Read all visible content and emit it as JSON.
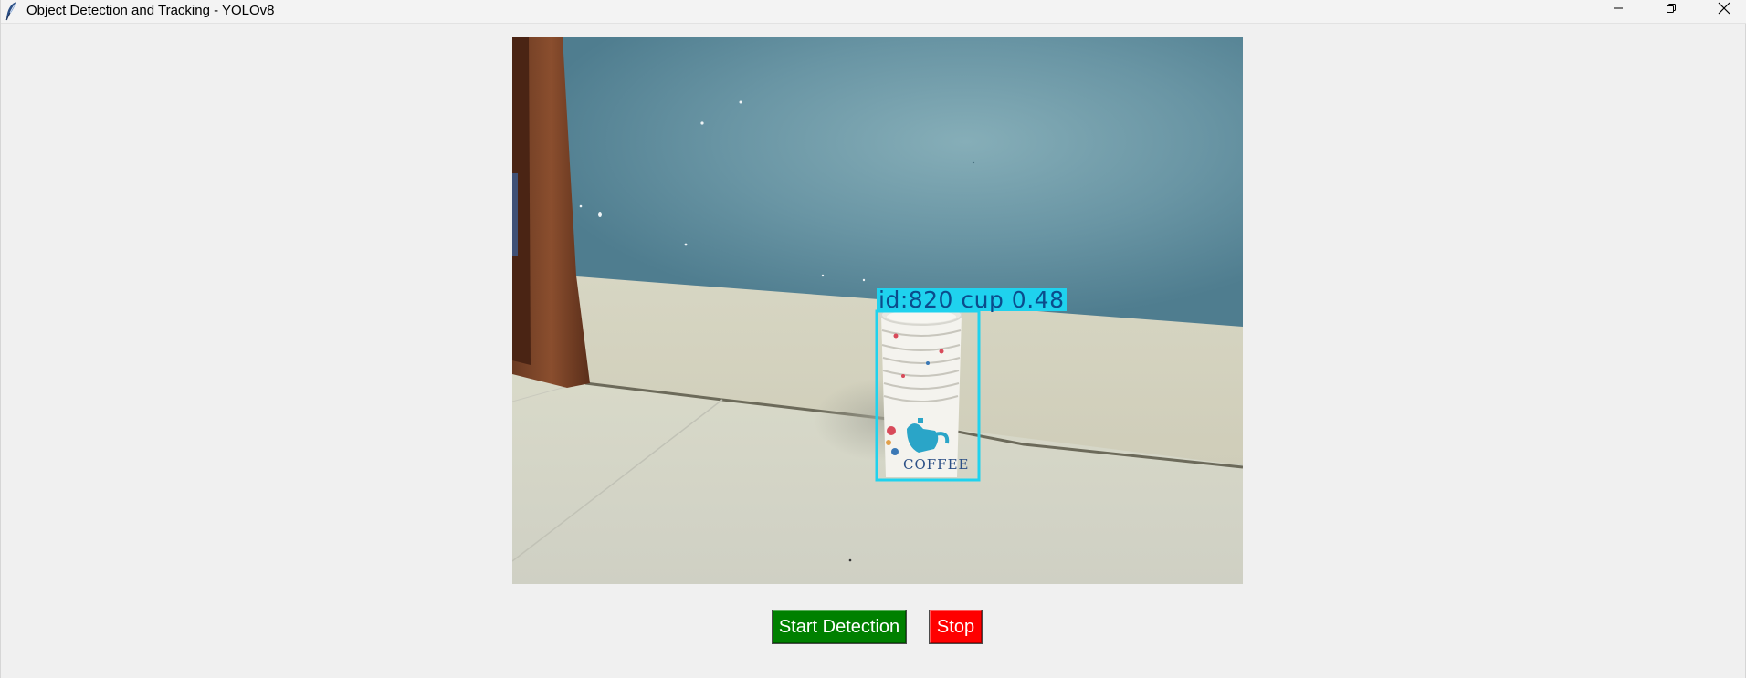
{
  "window": {
    "title": "Object Detection and Tracking - YOLOv8"
  },
  "video": {
    "detection": {
      "track_id": 820,
      "class": "cup",
      "confidence": 0.48,
      "label": "id:820 cup 0.48",
      "box_color": "#1fd2ee",
      "cup_print_text": "COFFEE"
    }
  },
  "controls": {
    "start_label": "Start Detection",
    "stop_label": "Stop"
  },
  "colors": {
    "start_button": "#008000",
    "stop_button": "#ff0000",
    "detection_box": "#1fd2ee",
    "wall": "#5f8c9b",
    "floor": "#d8d9cc"
  },
  "icons": {
    "app": "feather-icon",
    "minimize": "minimize-icon",
    "maximize": "restore-icon",
    "close": "close-icon"
  }
}
